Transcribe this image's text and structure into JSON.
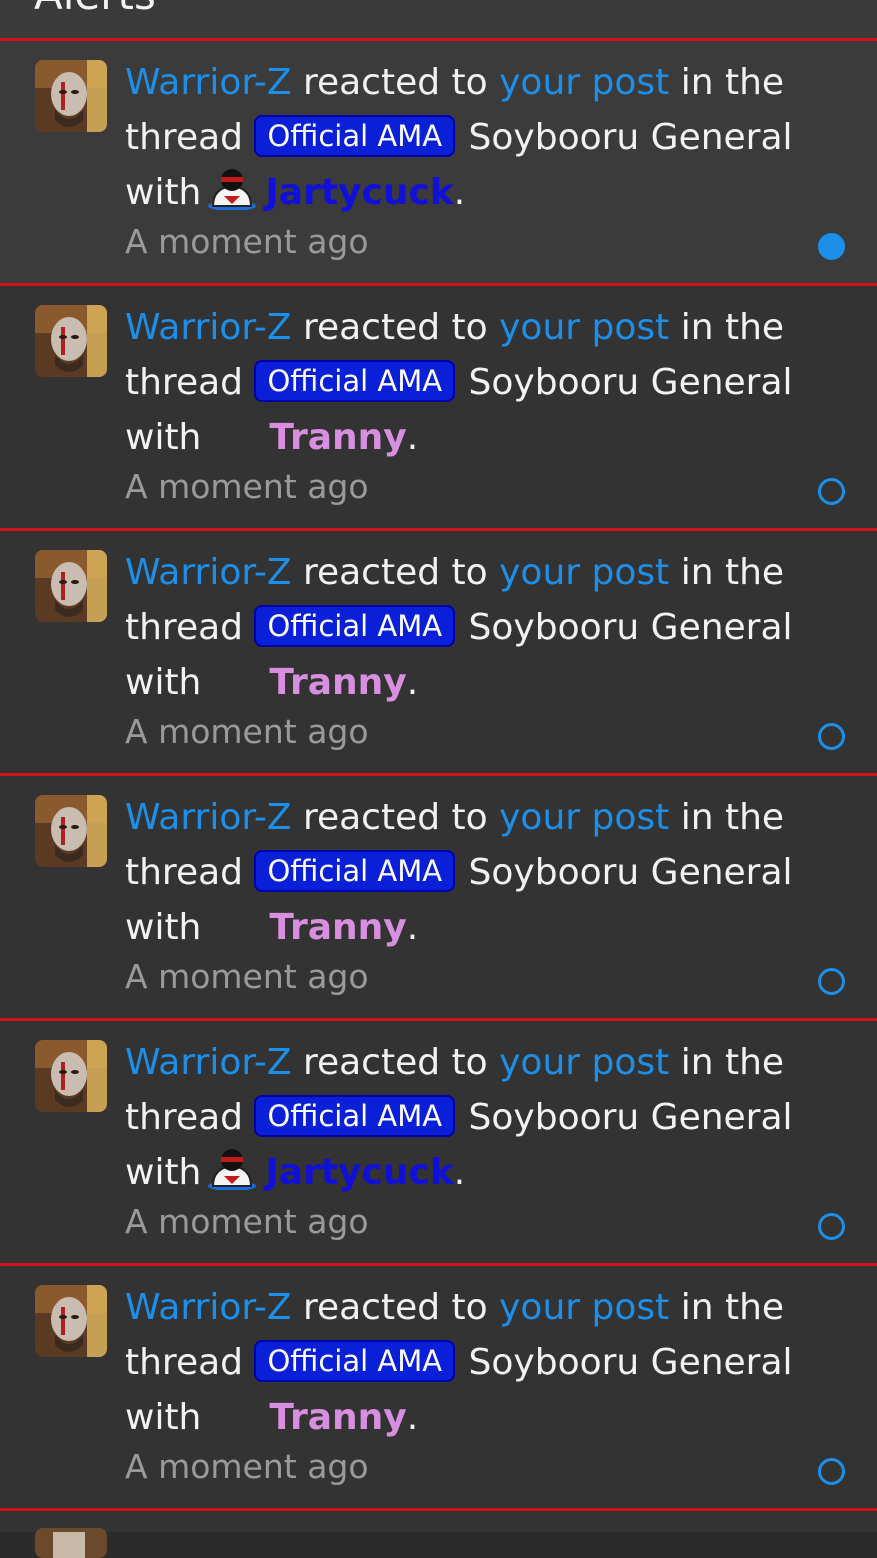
{
  "header": {
    "title": "Alerts"
  },
  "alerts": [
    {
      "user": "Warrior-Z",
      "verb": "reacted to",
      "post_link": "your post",
      "in_the": "in the",
      "thread_word": "thread",
      "prefix": "Official AMA",
      "thread_title": "Soybooru General",
      "with_word": "with",
      "reaction": "Jartycuck",
      "reaction_color": "#1010d8",
      "reaction_icon": "jartycuck-icon",
      "period": ".",
      "time": "A moment ago",
      "unread": true
    },
    {
      "user": "Warrior-Z",
      "verb": "reacted to",
      "post_link": "your post",
      "in_the": "in the",
      "thread_word": "thread",
      "prefix": "Official AMA",
      "thread_title": "Soybooru General",
      "with_word": "with",
      "reaction": "Tranny",
      "reaction_color": "#d88fe0",
      "reaction_icon": "",
      "period": ".",
      "time": "A moment ago",
      "unread": false
    },
    {
      "user": "Warrior-Z",
      "verb": "reacted to",
      "post_link": "your post",
      "in_the": "in the",
      "thread_word": "thread",
      "prefix": "Official AMA",
      "thread_title": "Soybooru General",
      "with_word": "with",
      "reaction": "Tranny",
      "reaction_color": "#d88fe0",
      "reaction_icon": "",
      "period": ".",
      "time": "A moment ago",
      "unread": false
    },
    {
      "user": "Warrior-Z",
      "verb": "reacted to",
      "post_link": "your post",
      "in_the": "in the",
      "thread_word": "thread",
      "prefix": "Official AMA",
      "thread_title": "Soybooru General",
      "with_word": "with",
      "reaction": "Tranny",
      "reaction_color": "#d88fe0",
      "reaction_icon": "",
      "period": ".",
      "time": "A moment ago",
      "unread": false
    },
    {
      "user": "Warrior-Z",
      "verb": "reacted to",
      "post_link": "your post",
      "in_the": "in the",
      "thread_word": "thread",
      "prefix": "Official AMA",
      "thread_title": "Soybooru General",
      "with_word": "with",
      "reaction": "Jartycuck",
      "reaction_color": "#1010d8",
      "reaction_icon": "jartycuck-icon",
      "period": ".",
      "time": "A moment ago",
      "unread": false
    },
    {
      "user": "Warrior-Z",
      "verb": "reacted to",
      "post_link": "your post",
      "in_the": "in the",
      "thread_word": "thread",
      "prefix": "Official AMA",
      "thread_title": "Soybooru General",
      "with_word": "with",
      "reaction": "Tranny",
      "reaction_color": "#d88fe0",
      "reaction_icon": "",
      "period": ".",
      "time": "A moment ago",
      "unread": false
    }
  ],
  "colors": {
    "link": "#1d8fe8",
    "divider": "#d0131a",
    "prefix_bg": "#0a20d8",
    "timestamp": "#9a9a9a"
  }
}
